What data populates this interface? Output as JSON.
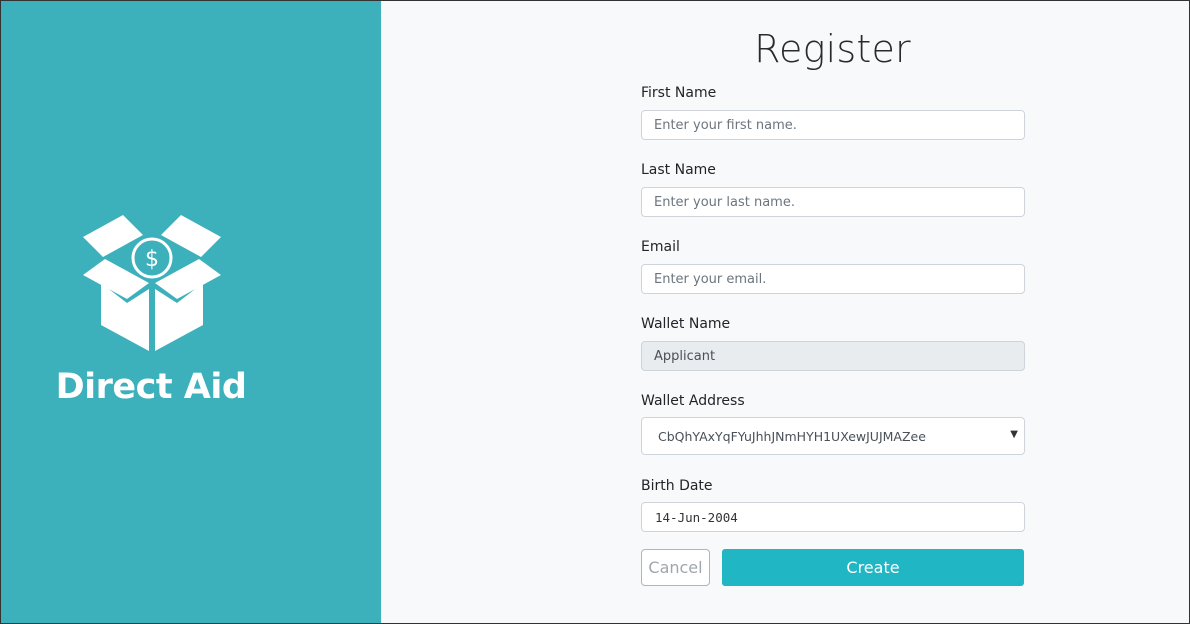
{
  "brand": {
    "name": "Direct Aid",
    "logo_icon": "box-dollar-icon",
    "color": "#3cb0bb"
  },
  "form": {
    "title": "Register",
    "fields": {
      "first_name": {
        "label": "First Name",
        "placeholder": "Enter your first name.",
        "value": ""
      },
      "last_name": {
        "label": "Last Name",
        "placeholder": "Enter your last name.",
        "value": ""
      },
      "email": {
        "label": "Email",
        "placeholder": "Enter your email.",
        "value": ""
      },
      "wallet_name": {
        "label": "Wallet Name",
        "value": "Applicant"
      },
      "wallet_address": {
        "label": "Wallet Address",
        "selected": "CbQhYAxYqFYuJhhJNmHYH1UXewJUJMAZee"
      },
      "birth_date": {
        "label": "Birth Date",
        "value": "14-Jun-2004"
      }
    },
    "buttons": {
      "cancel": "Cancel",
      "create": "Create"
    },
    "accent_color": "#20b6c4"
  }
}
